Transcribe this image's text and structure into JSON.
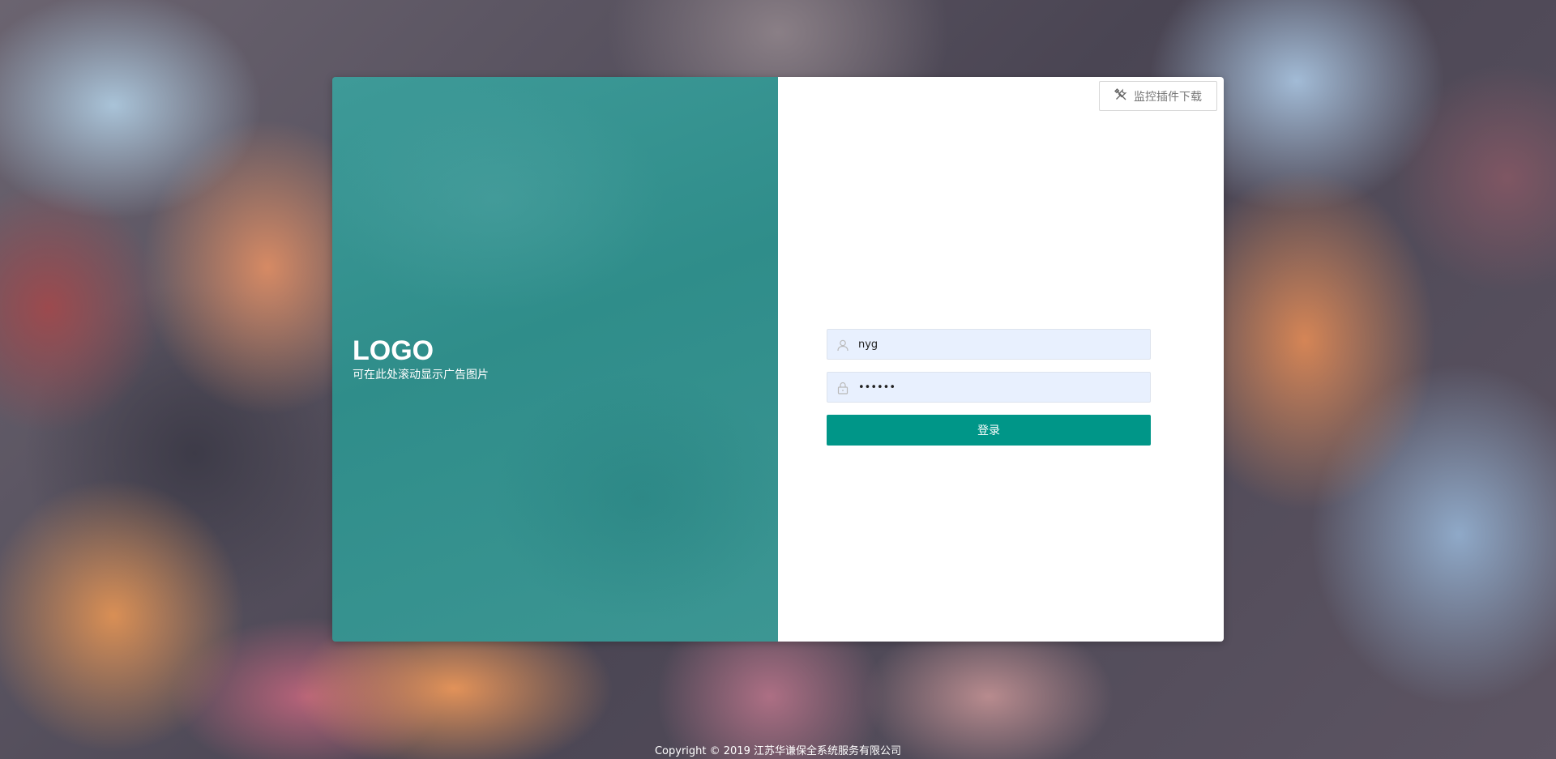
{
  "brand": {
    "logo_text": "LOGO",
    "subtitle": "可在此处滚动显示广告图片"
  },
  "toolbar": {
    "plugin_download_label": "监控插件下载",
    "plugin_icon": "tools-icon"
  },
  "login_form": {
    "username": {
      "icon": "user-icon",
      "value": "nyg"
    },
    "password": {
      "icon": "lock-icon",
      "value": "nygnyg"
    },
    "submit_label": "登录"
  },
  "footer": {
    "copyright": "Copyright © 2019 江苏华谦保全系统服务有限公司"
  },
  "colors": {
    "accent": "#009688",
    "panel_teal": "#3a9592",
    "input_bg": "#e8f0fe"
  }
}
